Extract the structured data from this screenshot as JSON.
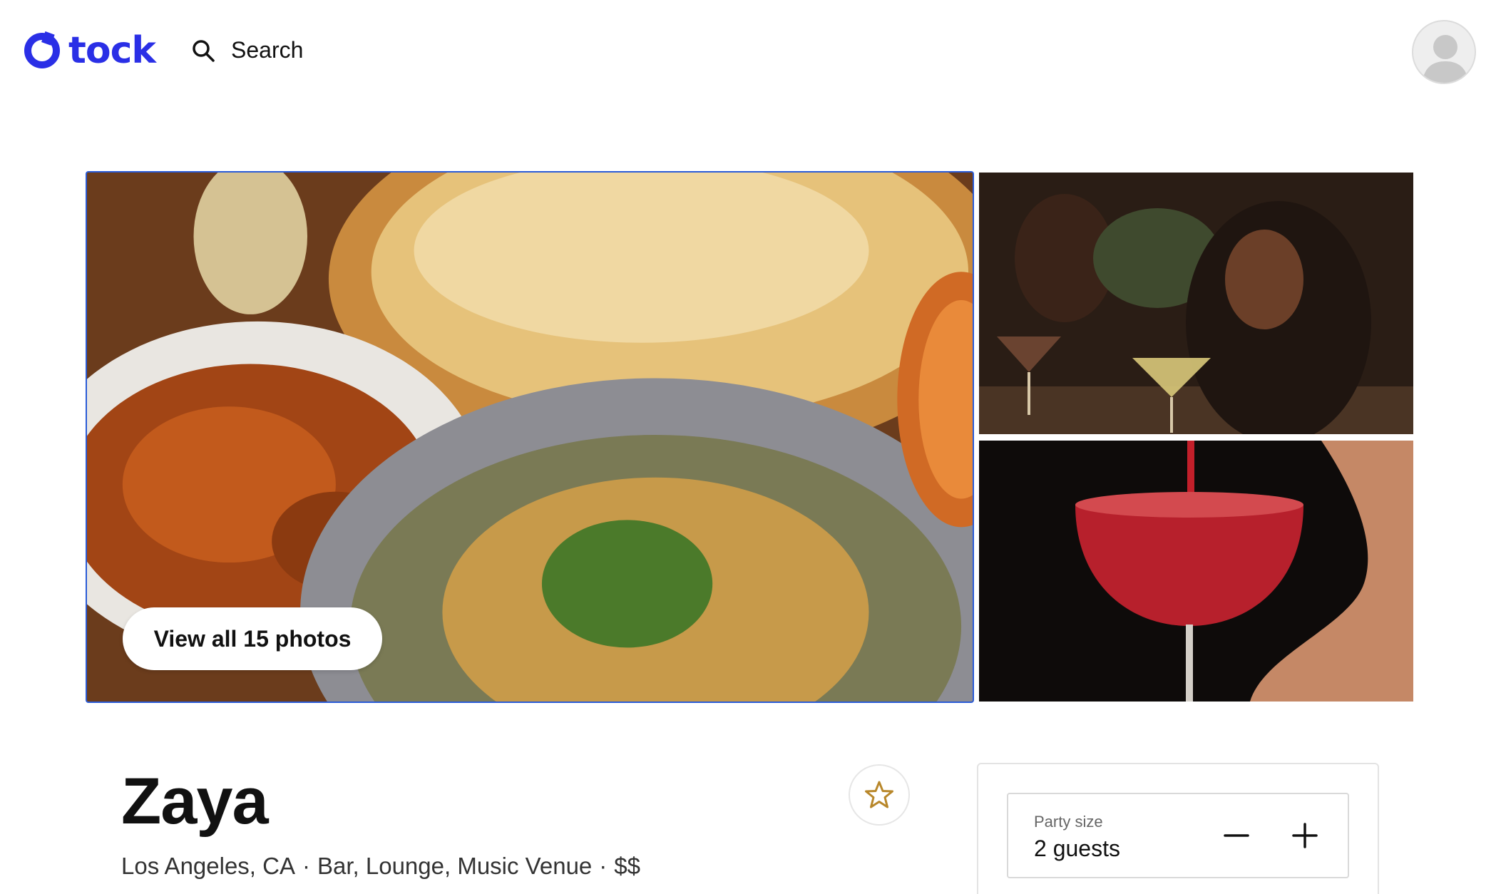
{
  "header": {
    "logo_text": "tock",
    "search_label": "Search",
    "brand_color": "#2a2fe6"
  },
  "gallery": {
    "view_all_label": "View all 15 photos",
    "photos": [
      {
        "name": "food-spread-photo"
      },
      {
        "name": "guests-at-bar-photo"
      },
      {
        "name": "red-cocktail-photo"
      }
    ]
  },
  "restaurant": {
    "name": "Zaya",
    "location": "Los Angeles, CA",
    "categories": "Bar, Lounge, Music Venue",
    "price": "$$",
    "separator": "·"
  },
  "booking": {
    "party_size_label": "Party size",
    "party_size_value": "2 guests"
  },
  "icons": {
    "search": "search-icon",
    "favorite": "star-icon",
    "decrease": "minus-icon",
    "increase": "plus-icon",
    "avatar": "user-avatar-icon"
  },
  "colors": {
    "favorite_star": "#b8872a",
    "focus_outline": "#2a5bd7"
  }
}
